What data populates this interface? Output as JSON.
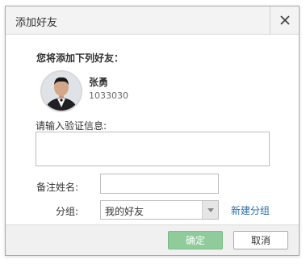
{
  "dialog": {
    "title": "添加好友",
    "heading": "您将添加下列好友：",
    "user": {
      "name": "张勇",
      "id": "1033030"
    },
    "verify_label": "请输入验证信息:",
    "verify_value": "",
    "remark_label": "备注姓名:",
    "remark_value": "",
    "group_label": "分组:",
    "group_selected": "我的好友",
    "new_group_link": "新建分组",
    "ok_label": "确定",
    "cancel_label": "取消"
  },
  "icons": {
    "close": "close-icon",
    "avatar": "user-avatar",
    "dropdown": "chevron-down-icon"
  },
  "colors": {
    "ok_button": "#8fcb9b",
    "link": "#2a6fa8",
    "title_bar": "#f3f3f3",
    "footer": "#f0f0f0"
  }
}
